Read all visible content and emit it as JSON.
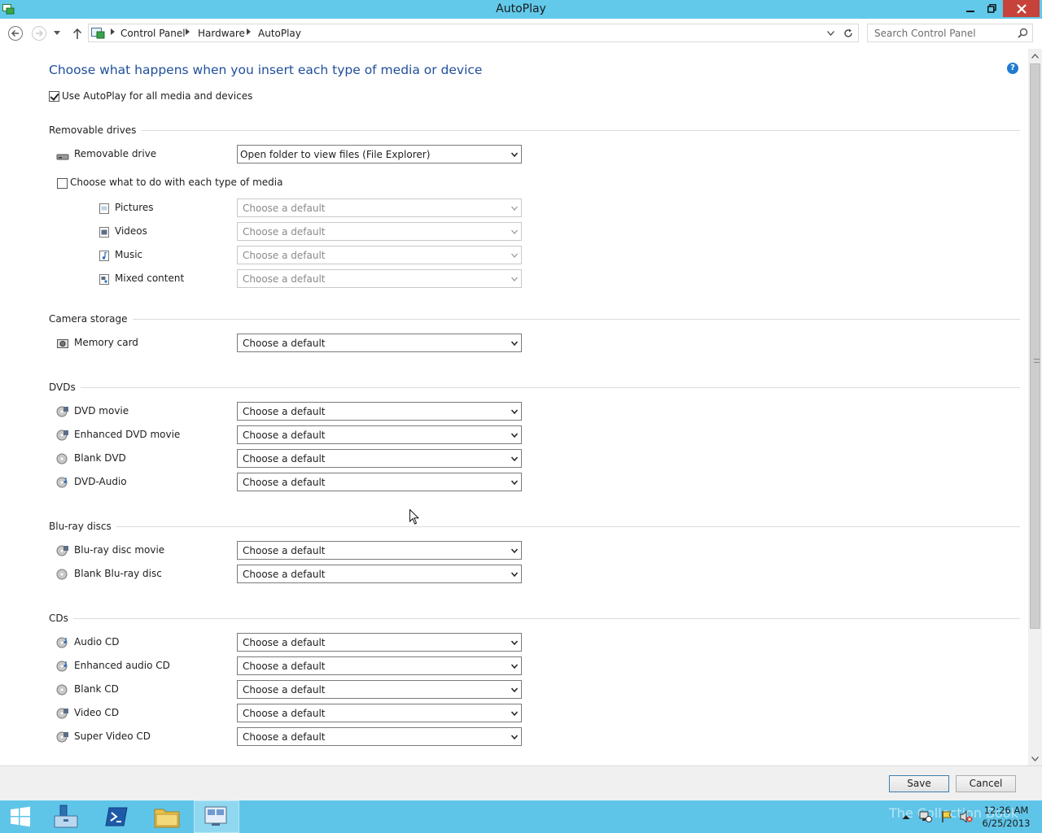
{
  "window": {
    "title": "AutoPlay"
  },
  "address_bar": {
    "crumbs": [
      "Control Panel",
      "Hardware",
      "AutoPlay"
    ],
    "search_placeholder": "Search Control Panel"
  },
  "main": {
    "heading": "Choose what happens when you insert each type of media or device",
    "use_autoplay": {
      "label": "Use AutoPlay for all media and devices",
      "checked": true
    },
    "choose_media": {
      "label": "Choose what to do with each type of media",
      "checked": false
    },
    "sections": {
      "removable": "Removable drives",
      "camera": "Camera storage",
      "dvds": "DVDs",
      "bluray": "Blu-ray discs",
      "cds": "CDs"
    },
    "rows": {
      "removable_drive": {
        "label": "Removable drive",
        "value": "Open folder to view files (File Explorer)"
      },
      "pictures": {
        "label": "Pictures",
        "value": "Choose a default"
      },
      "videos": {
        "label": "Videos",
        "value": "Choose a default"
      },
      "music": {
        "label": "Music",
        "value": "Choose a default"
      },
      "mixed": {
        "label": "Mixed content",
        "value": "Choose a default"
      },
      "memory_card": {
        "label": "Memory card",
        "value": "Choose a default"
      },
      "dvd_movie": {
        "label": "DVD movie",
        "value": "Choose a default"
      },
      "enhanced_dvd": {
        "label": "Enhanced DVD movie",
        "value": "Choose a default"
      },
      "blank_dvd": {
        "label": "Blank DVD",
        "value": "Choose a default"
      },
      "dvd_audio": {
        "label": "DVD-Audio",
        "value": "Choose a default"
      },
      "bluray_movie": {
        "label": "Blu-ray disc movie",
        "value": "Choose a default"
      },
      "blank_bluray": {
        "label": "Blank Blu-ray disc",
        "value": "Choose a default"
      },
      "audio_cd": {
        "label": "Audio CD",
        "value": "Choose a default"
      },
      "enhanced_audio_cd": {
        "label": "Enhanced audio CD",
        "value": "Choose a default"
      },
      "blank_cd": {
        "label": "Blank CD",
        "value": "Choose a default"
      },
      "video_cd": {
        "label": "Video CD",
        "value": "Choose a default"
      },
      "super_video_cd": {
        "label": "Super Video CD",
        "value": "Choose a default"
      }
    }
  },
  "footer": {
    "save": "Save",
    "cancel": "Cancel"
  },
  "taskbar": {
    "clock_time": "12:26 AM",
    "clock_date": "6/25/2013",
    "watermark": "The Collection Book"
  },
  "colors": {
    "titlebar": "#62c9ea",
    "taskbar": "#5fc5e8",
    "heading": "#1f4e99",
    "close": "#c7423a"
  }
}
